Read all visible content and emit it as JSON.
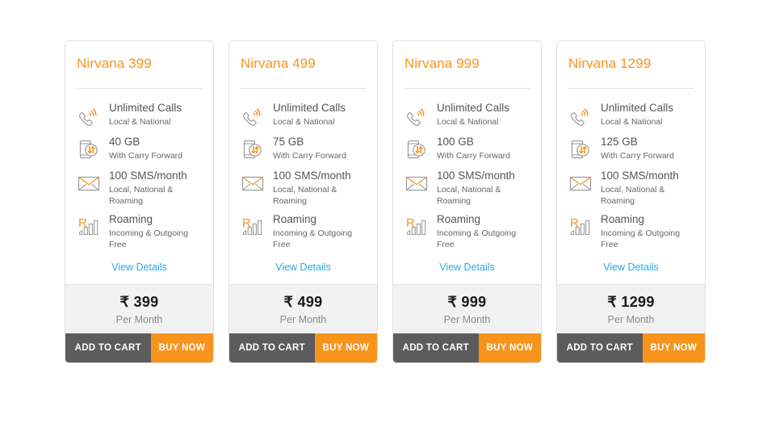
{
  "labels": {
    "view_details": "View Details",
    "per_month": "Per Month",
    "add_to_cart": "ADD TO CART",
    "buy_now": "BUY NOW",
    "currency_symbol": "₹"
  },
  "colors": {
    "accent_orange": "#f7941e",
    "link_blue": "#29abe2",
    "button_dark": "#5c5c5c",
    "price_band": "#f2f2f2",
    "card_border": "#e0e0e0"
  },
  "icons": {
    "calls": "phone-signal-icon",
    "data": "data-transfer-icon",
    "sms": "envelope-icon",
    "roaming": "roaming-signal-bars-icon"
  },
  "plans": [
    {
      "title": "Nirvana 399",
      "price": "399",
      "price_display": "₹ 399",
      "features": [
        {
          "icon": "phone-signal-icon",
          "main": "Unlimited Calls",
          "sub": "Local & National"
        },
        {
          "icon": "data-transfer-icon",
          "main": "40 GB",
          "sub": "With Carry Forward"
        },
        {
          "icon": "envelope-icon",
          "main": "100 SMS/month",
          "sub": "Local, National & Roaming"
        },
        {
          "icon": "roaming-signal-bars-icon",
          "main": "Roaming",
          "sub": "Incoming & Outgoing Free"
        }
      ]
    },
    {
      "title": "Nirvana 499",
      "price": "499",
      "price_display": "₹ 499",
      "features": [
        {
          "icon": "phone-signal-icon",
          "main": "Unlimited Calls",
          "sub": "Local & National"
        },
        {
          "icon": "data-transfer-icon",
          "main": "75 GB",
          "sub": "With Carry Forward"
        },
        {
          "icon": "envelope-icon",
          "main": "100 SMS/month",
          "sub": "Local, National & Roaming"
        },
        {
          "icon": "roaming-signal-bars-icon",
          "main": "Roaming",
          "sub": "Incoming & Outgoing Free"
        }
      ]
    },
    {
      "title": "Nirvana 999",
      "price": "999",
      "price_display": "₹ 999",
      "features": [
        {
          "icon": "phone-signal-icon",
          "main": "Unlimited Calls",
          "sub": "Local & National"
        },
        {
          "icon": "data-transfer-icon",
          "main": "100 GB",
          "sub": "With Carry Forward"
        },
        {
          "icon": "envelope-icon",
          "main": "100 SMS/month",
          "sub": "Local, National & Roaming"
        },
        {
          "icon": "roaming-signal-bars-icon",
          "main": "Roaming",
          "sub": "Incoming & Outgoing Free"
        }
      ]
    },
    {
      "title": "Nirvana 1299",
      "price": "1299",
      "price_display": "₹ 1299",
      "features": [
        {
          "icon": "phone-signal-icon",
          "main": "Unlimited Calls",
          "sub": "Local & National"
        },
        {
          "icon": "data-transfer-icon",
          "main": "125 GB",
          "sub": "With Carry Forward"
        },
        {
          "icon": "envelope-icon",
          "main": "100 SMS/month",
          "sub": "Local, National & Roaming"
        },
        {
          "icon": "roaming-signal-bars-icon",
          "main": "Roaming",
          "sub": "Incoming & Outgoing Free"
        }
      ]
    }
  ]
}
